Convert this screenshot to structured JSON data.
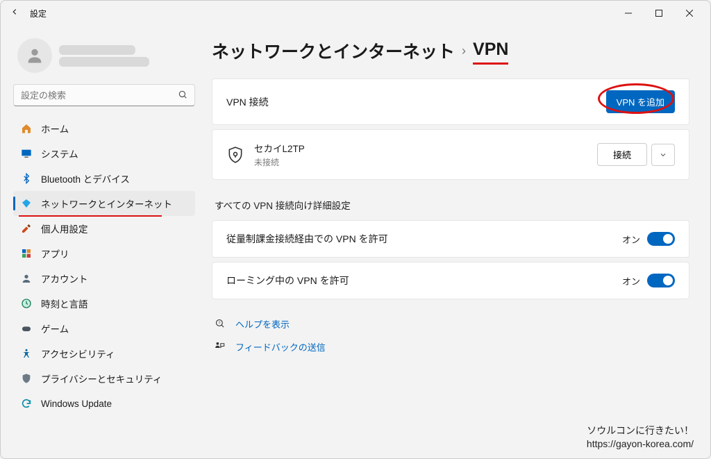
{
  "window": {
    "title": "設定"
  },
  "user": {
    "name_hidden": true
  },
  "search": {
    "placeholder": "設定の検索"
  },
  "sidebar": {
    "items": [
      {
        "label": "ホーム"
      },
      {
        "label": "システム"
      },
      {
        "label": "Bluetooth とデバイス"
      },
      {
        "label": "ネットワークとインターネット"
      },
      {
        "label": "個人用設定"
      },
      {
        "label": "アプリ"
      },
      {
        "label": "アカウント"
      },
      {
        "label": "時刻と言語"
      },
      {
        "label": "ゲーム"
      },
      {
        "label": "アクセシビリティ"
      },
      {
        "label": "プライバシーとセキュリティ"
      },
      {
        "label": "Windows Update"
      }
    ]
  },
  "breadcrumb": {
    "parent": "ネットワークとインターネット",
    "current": "VPN"
  },
  "vpn": {
    "header_label": "VPN 接続",
    "add_button": "VPN を追加",
    "connections": [
      {
        "name": "セカイL2TP",
        "status": "未接続",
        "connect_label": "接続"
      }
    ]
  },
  "advanced": {
    "section_title": "すべての VPN 接続向け詳細設定",
    "rows": [
      {
        "label": "従量制課金接続経由での VPN を許可",
        "state_text": "オン",
        "on": true
      },
      {
        "label": "ローミング中の VPN を許可",
        "state_text": "オン",
        "on": true
      }
    ]
  },
  "links": {
    "help": "ヘルプを表示",
    "feedback": "フィードバックの送信"
  },
  "watermark": {
    "line1": "ソウルコンに行きたい！",
    "line2": "https://gayon-korea.com/"
  }
}
